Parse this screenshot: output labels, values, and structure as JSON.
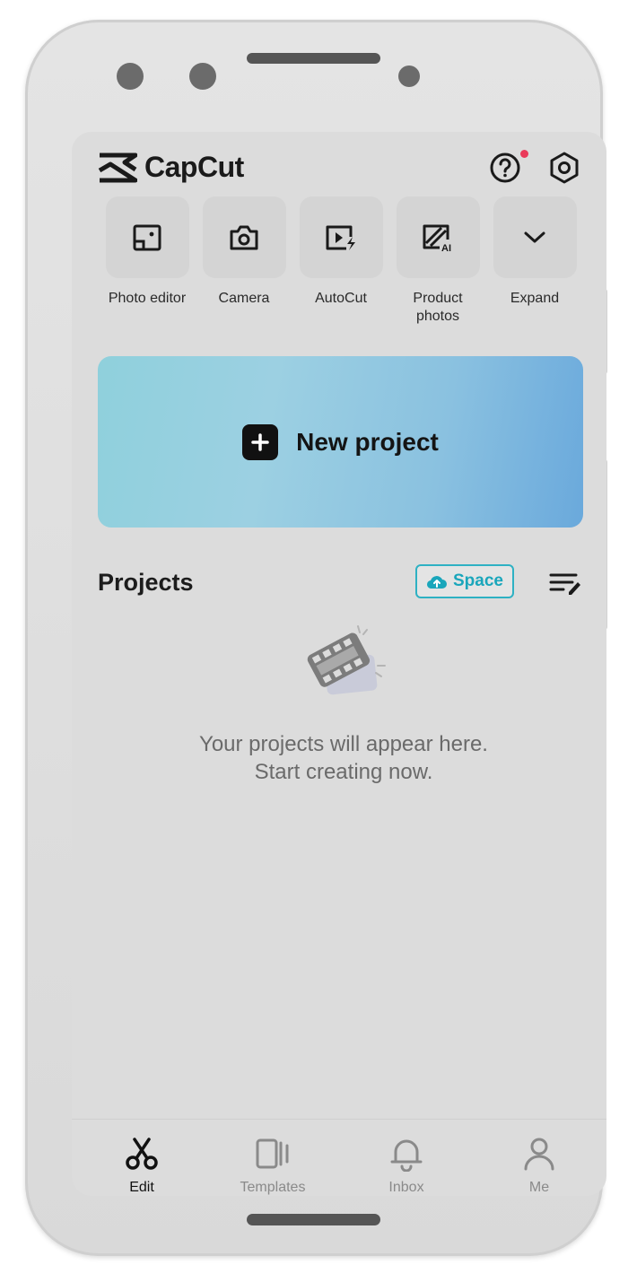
{
  "app": {
    "name": "CapCut"
  },
  "tools": [
    {
      "label": "Photo editor",
      "icon": "photo-editor-icon"
    },
    {
      "label": "Camera",
      "icon": "camera-icon"
    },
    {
      "label": "AutoCut",
      "icon": "autocut-icon"
    },
    {
      "label": "Product\nphotos",
      "icon": "product-photos-ai-icon"
    },
    {
      "label": "Expand",
      "icon": "chevron-down-icon"
    }
  ],
  "new_project": {
    "label": "New project"
  },
  "projects": {
    "title": "Projects",
    "space_label": "Space",
    "empty_line1": "Your projects will appear here.",
    "empty_line2": "Start creating now."
  },
  "tabs": [
    {
      "label": "Edit",
      "icon": "scissors-icon",
      "active": true
    },
    {
      "label": "Templates",
      "icon": "templates-icon",
      "active": false
    },
    {
      "label": "Inbox",
      "icon": "bell-icon",
      "active": false
    },
    {
      "label": "Me",
      "icon": "person-icon",
      "active": false
    }
  ],
  "colors": {
    "accent": "#1aa6bb",
    "notification": "#ea3a5a",
    "banner_start": "#8fd0dc",
    "banner_end": "#6aa9dc"
  }
}
